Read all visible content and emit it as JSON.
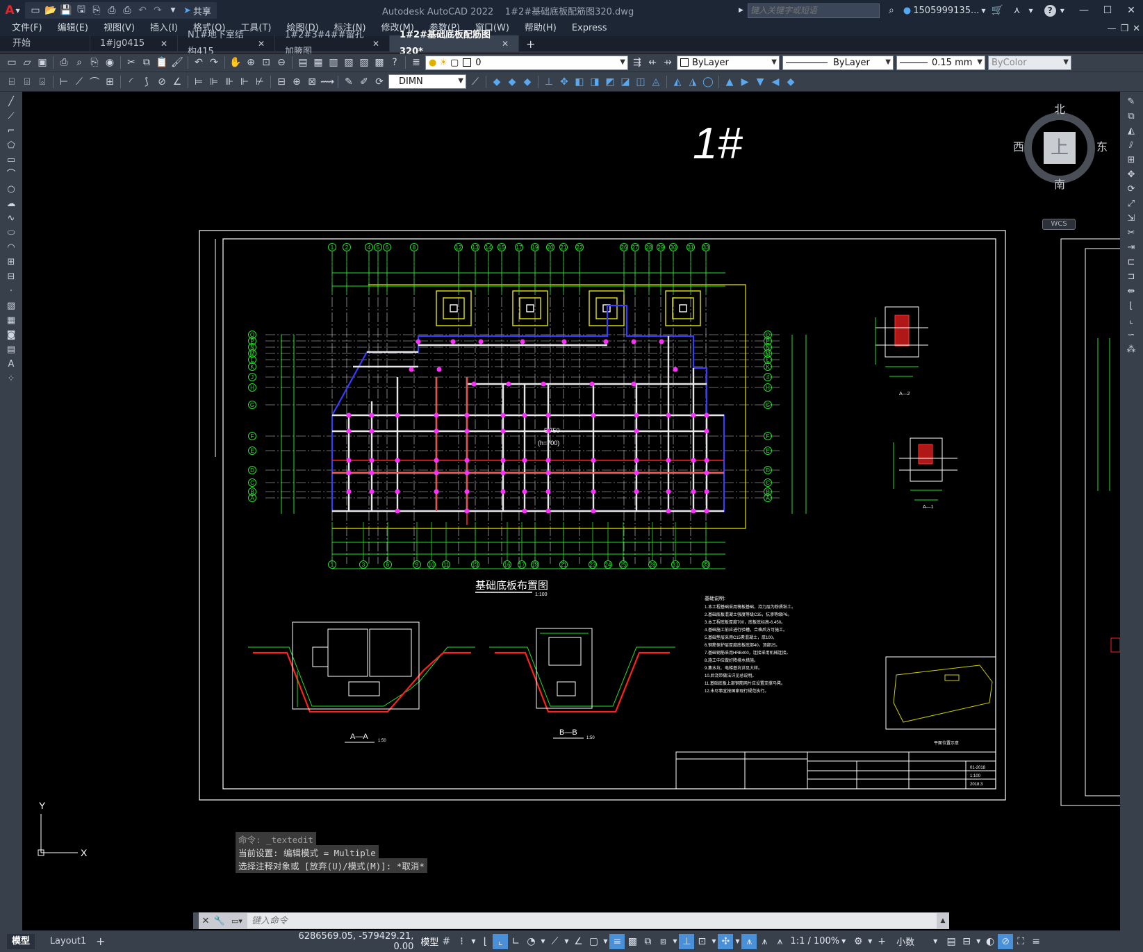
{
  "app": {
    "title": "Autodesk AutoCAD 2022",
    "filename": "1#2#基础底板配筋图320.dwg",
    "share_label": "共享",
    "search_placeholder": "键入关键字或短语",
    "user": "1505999135...",
    "brand_color": "#e0262b"
  },
  "menu": [
    "文件(F)",
    "编辑(E)",
    "视图(V)",
    "插入(I)",
    "格式(O)",
    "工具(T)",
    "绘图(D)",
    "标注(N)",
    "修改(M)",
    "参数(P)",
    "窗口(W)",
    "帮助(H)",
    "Express"
  ],
  "tabs": [
    {
      "label": "开始",
      "closable": false,
      "active": false
    },
    {
      "label": "1#jg0415",
      "closable": true,
      "active": false
    },
    {
      "label": "N1#地下室结构415",
      "closable": true,
      "active": false
    },
    {
      "label": "1#2#3#4##留孔加腋图",
      "closable": true,
      "active": false
    },
    {
      "label": "1#2#基础底板配筋图320*",
      "closable": true,
      "active": true
    }
  ],
  "properties": {
    "layer": "0",
    "color": "ByLayer",
    "linetype": "ByLayer",
    "lineweight": "0.15 mm",
    "plotstyle": "ByColor",
    "dimstyle": "DIMN"
  },
  "viewcube": {
    "north": "北",
    "south": "南",
    "east": "东",
    "west": "西",
    "top": "上",
    "ucs": "WCS"
  },
  "drawing": {
    "sheet_number": "1#",
    "plan_title": "基础底板布置图",
    "plan_scale": "1:100",
    "section_aa": "A—A",
    "section_bb": "B—B",
    "section_scale": "1:50",
    "sub_section_1": "A—1",
    "sub_section_2": "A—2",
    "elevation_note": "-5.750",
    "thickness_note": "(h=700)",
    "notes_title": "基础说明:",
    "notes": [
      "1.本工程基础采用筏板基础，持力层为粉质粘土。",
      "2.基础底板混凝土强度等级C35，抗渗等级P6。",
      "3.本工程底板厚度700，底板底标高-6.450。",
      "4.基础施工前应进行验槽，合格后方可施工。",
      "5.基础垫层采用C15素混凝土，厚100。",
      "6.钢筋保护层厚度底板底部40，顶部25。",
      "7.基础钢筋采用HRB400，连接采用机械连接。",
      "8.施工中应做好降排水措施。",
      "9.集水坑、电梯基坑详见大样。",
      "10.后浇带做法详见总说明。",
      "11.基础底板上部钢筋网片应设置支撑马凳。",
      "12.未尽事宜按国家现行规范执行。"
    ],
    "keyplan_label": "平面位置示意",
    "title_block": {
      "drawing_no": "01-2018",
      "scale": "1:100",
      "date": "2018.3"
    }
  },
  "command": {
    "history": [
      "命令: _textedit",
      "当前设置: 编辑模式 = Multiple",
      "选择注释对象或 [放弃(U)/模式(M)]: *取消*"
    ],
    "placeholder": "键入命令"
  },
  "layouts": [
    "模型",
    "Layout1"
  ],
  "status": {
    "coords": "6286569.05, -579429.21, 0.00",
    "model": "模型",
    "annotation_scale": "1:1 / 100%",
    "units": "小数"
  },
  "axis_top": [
    "1",
    "2",
    "4",
    "5",
    "6",
    "8",
    "12",
    "13",
    "14",
    "15",
    "17",
    "19",
    "20",
    "21",
    "22",
    "26",
    "27",
    "28",
    "29",
    "30",
    "31",
    "33"
  ],
  "axis_bottom": [
    "1",
    "3",
    "6",
    "9",
    "10",
    "11",
    "13",
    "16",
    "17",
    "18",
    "21",
    "23",
    "24",
    "25",
    "28",
    "31",
    "33"
  ],
  "axis_rows_left": [
    "Q",
    "P",
    "N",
    "M",
    "L",
    "K",
    "J",
    "H",
    "G",
    "F",
    "E",
    "D",
    "C",
    "B",
    "A"
  ]
}
